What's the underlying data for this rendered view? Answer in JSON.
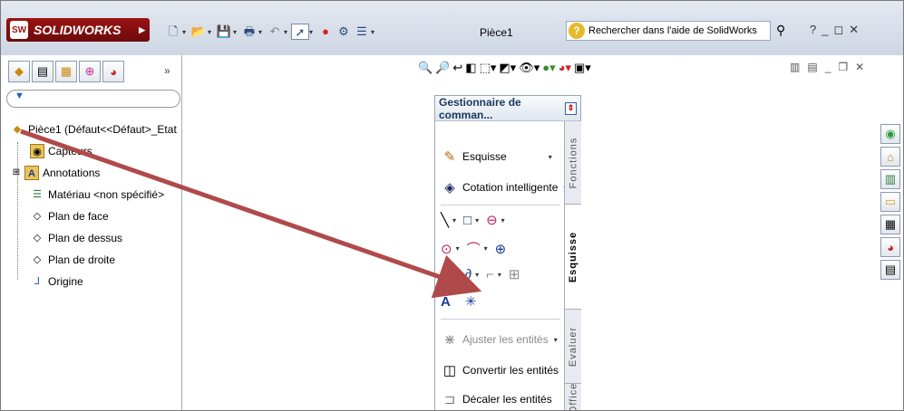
{
  "app": {
    "brand": "SOLIDWORKS",
    "doc_title": "Pièce1"
  },
  "help": {
    "placeholder": "Rechercher dans l'aide de SolidWorks"
  },
  "tree": {
    "root": "Pièce1  (Défaut<<Défaut>_Etat",
    "items": [
      "Capteurs",
      "Annotations",
      "Matériau <non spécifié>",
      "Plan de face",
      "Plan de dessus",
      "Plan de droite",
      "Origine"
    ]
  },
  "command_manager": {
    "title": "Gestionnaire de comman...",
    "items": {
      "esquisse": "Esquisse",
      "cotation": "Cotation intelligente",
      "ajuster": "Ajuster les entités",
      "convertir": "Convertir les entités",
      "decaler": "Décaler les entités"
    },
    "tabs": [
      "Fonctions",
      "Esquisse",
      "Evaluer",
      "Office"
    ]
  },
  "colors": {
    "brand": "#9a1212",
    "arrow": "#b04a4a",
    "accent": "#2060c0"
  }
}
